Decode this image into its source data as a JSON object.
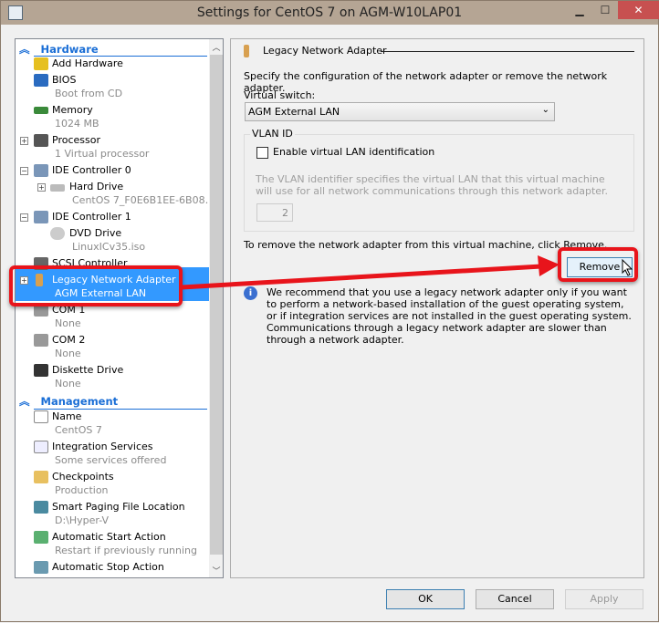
{
  "window": {
    "title": "Settings for CentOS 7 on AGM-W10LAP01",
    "minimize": "▁",
    "maximize": "☐",
    "close": "✕"
  },
  "tree": {
    "hardware_header": "Hardware",
    "management_header": "Management",
    "items": [
      {
        "label": "Add Hardware",
        "sub": ""
      },
      {
        "label": "BIOS",
        "sub": "Boot from CD"
      },
      {
        "label": "Memory",
        "sub": "1024 MB"
      },
      {
        "label": "Processor",
        "sub": "1 Virtual processor"
      },
      {
        "label": "IDE Controller 0",
        "sub": ""
      },
      {
        "label": "Hard Drive",
        "sub": "CentOS 7_F0E6B1EE-6B08…"
      },
      {
        "label": "IDE Controller 1",
        "sub": ""
      },
      {
        "label": "DVD Drive",
        "sub": "LinuxICv35.iso"
      },
      {
        "label": "SCSI Controller",
        "sub": ""
      },
      {
        "label": "Legacy Network Adapter",
        "sub": "AGM External LAN"
      },
      {
        "label": "COM 1",
        "sub": "None"
      },
      {
        "label": "COM 2",
        "sub": "None"
      },
      {
        "label": "Diskette Drive",
        "sub": "None"
      }
    ],
    "management": [
      {
        "label": "Name",
        "sub": "CentOS 7"
      },
      {
        "label": "Integration Services",
        "sub": "Some services offered"
      },
      {
        "label": "Checkpoints",
        "sub": "Production"
      },
      {
        "label": "Smart Paging File Location",
        "sub": "D:\\Hyper-V"
      },
      {
        "label": "Automatic Start Action",
        "sub": "Restart if previously running"
      },
      {
        "label": "Automatic Stop Action",
        "sub": ""
      }
    ]
  },
  "panel": {
    "title": "Legacy Network Adapter",
    "description": "Specify the configuration of the network adapter or remove the network adapter.",
    "switch_label": "Virtual switch:",
    "switch_value": "AGM External LAN",
    "vlan_group": "VLAN ID",
    "vlan_checkbox": "Enable virtual LAN identification",
    "vlan_checked": false,
    "vlan_help": "The VLAN identifier specifies the virtual LAN that this virtual machine will use for all network communications through this network adapter.",
    "vlan_value": "2",
    "remove_text": "To remove the network adapter from this virtual machine, click Remove.",
    "remove_button": "Remove",
    "info_text": "We recommend that you use a legacy network adapter only if you want to perform a network-based installation of the guest operating system, or if integration services are not installed in the guest operating system. Communications through a legacy network adapter are slower than through a network adapter."
  },
  "footer": {
    "ok": "OK",
    "cancel": "Cancel",
    "apply": "Apply"
  },
  "colors": {
    "accent": "#1a6ed6",
    "selection": "#3399ff",
    "annotation": "#e8141b",
    "titlebar": "#b5a594"
  }
}
